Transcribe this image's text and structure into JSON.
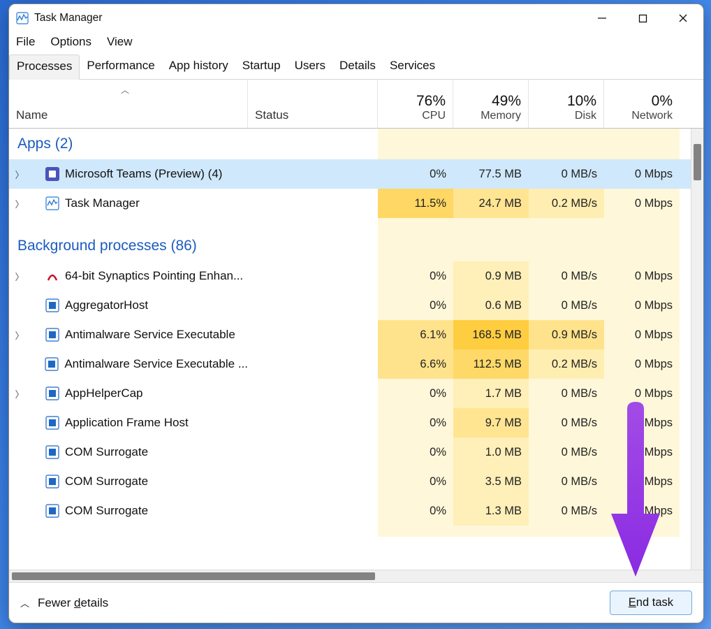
{
  "window": {
    "title": "Task Manager"
  },
  "menu": {
    "file": "File",
    "options": "Options",
    "view": "View"
  },
  "tabs": {
    "processes": "Processes",
    "performance": "Performance",
    "app_history": "App history",
    "startup": "Startup",
    "users": "Users",
    "details": "Details",
    "services": "Services"
  },
  "columns": {
    "name": "Name",
    "status": "Status",
    "cpu_pct": "76%",
    "cpu": "CPU",
    "mem_pct": "49%",
    "mem": "Memory",
    "disk_pct": "10%",
    "disk": "Disk",
    "net_pct": "0%",
    "net": "Network"
  },
  "groups": {
    "apps": "Apps (2)",
    "bg": "Background processes (86)"
  },
  "rows": [
    {
      "expand": true,
      "icon": "teams",
      "name": "Microsoft Teams (Preview) (4)",
      "cpu": "0%",
      "cpuH": 0,
      "mem": "77.5 MB",
      "memH": 2,
      "disk": "0 MB/s",
      "diskH": 0,
      "net": "0 Mbps",
      "netH": 0,
      "selected": true
    },
    {
      "expand": true,
      "icon": "tm",
      "name": "Task Manager",
      "cpu": "11.5%",
      "cpuH": 3,
      "mem": "24.7 MB",
      "memH": 2,
      "disk": "0.2 MB/s",
      "diskH": 1,
      "net": "0 Mbps",
      "netH": 0
    },
    {
      "expand": true,
      "icon": "syn",
      "name": "64-bit Synaptics Pointing Enhan...",
      "cpu": "0%",
      "cpuH": 0,
      "mem": "0.9 MB",
      "memH": 1,
      "disk": "0 MB/s",
      "diskH": 0,
      "net": "0 Mbps",
      "netH": 0
    },
    {
      "expand": false,
      "icon": "win",
      "name": "AggregatorHost",
      "cpu": "0%",
      "cpuH": 0,
      "mem": "0.6 MB",
      "memH": 1,
      "disk": "0 MB/s",
      "diskH": 0,
      "net": "0 Mbps",
      "netH": 0
    },
    {
      "expand": true,
      "icon": "win",
      "name": "Antimalware Service Executable",
      "cpu": "6.1%",
      "cpuH": 2,
      "mem": "168.5 MB",
      "memH": 4,
      "disk": "0.9 MB/s",
      "diskH": 2,
      "net": "0 Mbps",
      "netH": 0
    },
    {
      "expand": false,
      "icon": "win",
      "name": "Antimalware Service Executable ...",
      "cpu": "6.6%",
      "cpuH": 2,
      "mem": "112.5 MB",
      "memH": 3,
      "disk": "0.2 MB/s",
      "diskH": 1,
      "net": "0 Mbps",
      "netH": 0
    },
    {
      "expand": true,
      "icon": "win",
      "name": "AppHelperCap",
      "cpu": "0%",
      "cpuH": 0,
      "mem": "1.7 MB",
      "memH": 1,
      "disk": "0 MB/s",
      "diskH": 0,
      "net": "0 Mbps",
      "netH": 0
    },
    {
      "expand": false,
      "icon": "win",
      "name": "Application Frame Host",
      "cpu": "0%",
      "cpuH": 0,
      "mem": "9.7 MB",
      "memH": 2,
      "disk": "0 MB/s",
      "diskH": 0,
      "net": "0 Mbps",
      "netH": 0
    },
    {
      "expand": false,
      "icon": "win",
      "name": "COM Surrogate",
      "cpu": "0%",
      "cpuH": 0,
      "mem": "1.0 MB",
      "memH": 1,
      "disk": "0 MB/s",
      "diskH": 0,
      "net": "0 Mbps",
      "netH": 0
    },
    {
      "expand": false,
      "icon": "win",
      "name": "COM Surrogate",
      "cpu": "0%",
      "cpuH": 0,
      "mem": "3.5 MB",
      "memH": 1,
      "disk": "0 MB/s",
      "diskH": 0,
      "net": "0 Mbps",
      "netH": 0
    },
    {
      "expand": false,
      "icon": "win",
      "name": "COM Surrogate",
      "cpu": "0%",
      "cpuH": 0,
      "mem": "1.3 MB",
      "memH": 1,
      "disk": "0 MB/s",
      "diskH": 0,
      "net": "0 Mbps",
      "netH": 0
    }
  ],
  "bottom": {
    "fewer_pre": "Fewer ",
    "fewer_uline": "d",
    "fewer_post": "etails",
    "end_pre": "",
    "end_uline": "E",
    "end_post": "nd task"
  }
}
